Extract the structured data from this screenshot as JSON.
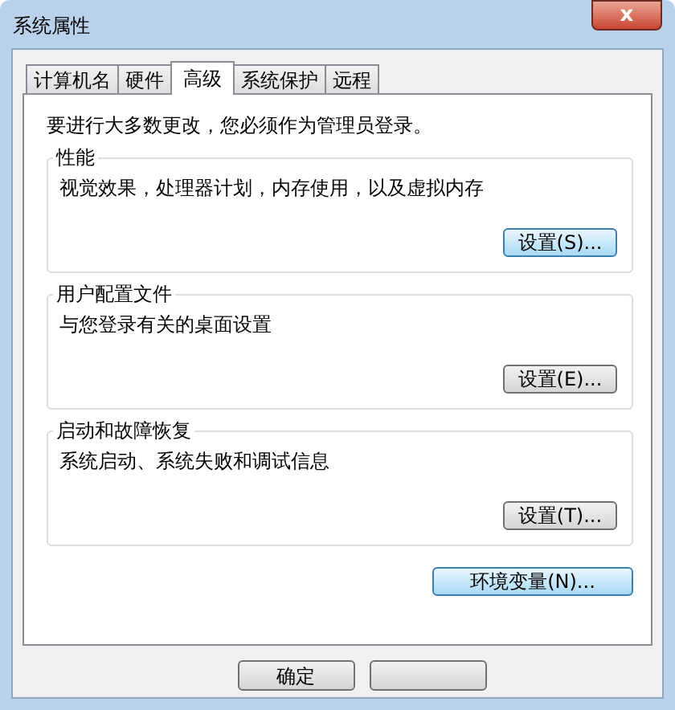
{
  "window": {
    "title": "系统属性",
    "close_glyph": "x"
  },
  "tabs": [
    {
      "label": "计算机名",
      "selected": false
    },
    {
      "label": "硬件",
      "selected": false
    },
    {
      "label": "高级",
      "selected": true
    },
    {
      "label": "系统保护",
      "selected": false
    },
    {
      "label": "远程",
      "selected": false
    }
  ],
  "notice": "要进行大多数更改，您必须作为管理员登录。",
  "groups": [
    {
      "title": "性能",
      "description": "视觉效果，处理器计划，内存使用，以及虚拟内存",
      "button": {
        "label": "设置(S)...",
        "focused": true
      }
    },
    {
      "title": "用户配置文件",
      "description": "与您登录有关的桌面设置",
      "button": {
        "label": "设置(E)...",
        "focused": false
      }
    },
    {
      "title": "启动和故障恢复",
      "description": "系统启动、系统失败和调试信息",
      "button": {
        "label": "设置(T)...",
        "focused": false
      }
    }
  ],
  "env_button": {
    "label": "环境变量(N)...",
    "focused": true
  },
  "dialog_buttons": [
    {
      "kind": "labeled",
      "label": "确定"
    },
    {
      "kind": "covered"
    }
  ]
}
